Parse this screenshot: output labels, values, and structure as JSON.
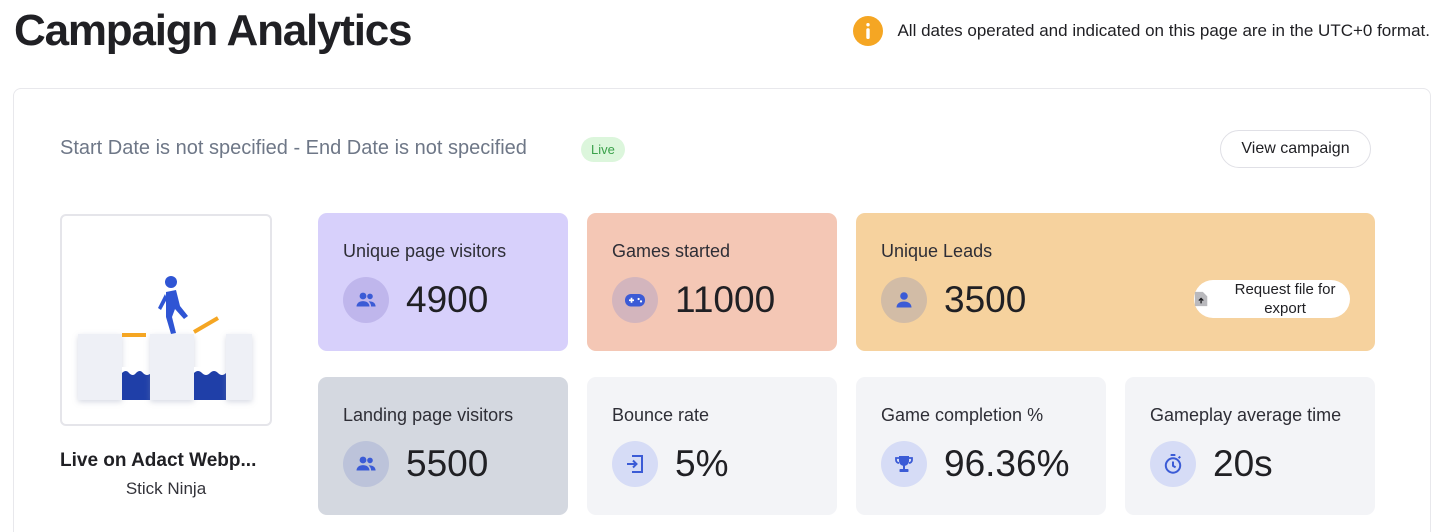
{
  "header": {
    "title": "Campaign Analytics",
    "notice": "All dates operated and indicated on this page are in the UTC+0 format."
  },
  "campaign": {
    "dates": "Start Date is not specified - End Date is not specified",
    "status": "Live",
    "view_button": "View campaign",
    "name": "Live on Adact Webp...",
    "game": "Stick Ninja"
  },
  "stats": {
    "unique_visitors": {
      "label": "Unique page visitors",
      "value": "4900",
      "icon": "users-icon"
    },
    "games_started": {
      "label": "Games started",
      "value": "11000",
      "icon": "gamepad-icon"
    },
    "unique_leads": {
      "label": "Unique Leads",
      "value": "3500",
      "icon": "person-icon",
      "export_label": "Request file for export"
    },
    "landing_visitors": {
      "label": "Landing page visitors",
      "value": "5500",
      "icon": "users-icon"
    },
    "bounce_rate": {
      "label": "Bounce rate",
      "value": "5%",
      "icon": "exit-icon"
    },
    "completion": {
      "label": "Game completion %",
      "value": "96.36%",
      "icon": "trophy-icon"
    },
    "avg_time": {
      "label": "Gameplay average time",
      "value": "20s",
      "icon": "timer-icon"
    }
  },
  "colors": {
    "purple": "#d7d0fb",
    "salmon": "#f4c7b5",
    "orange": "#f6d29e",
    "gray": "#d4d8e0",
    "light": "#f3f4f7",
    "accent": "#3b5bd6",
    "warning": "#f5a623",
    "live_bg": "#dcf6dc"
  }
}
